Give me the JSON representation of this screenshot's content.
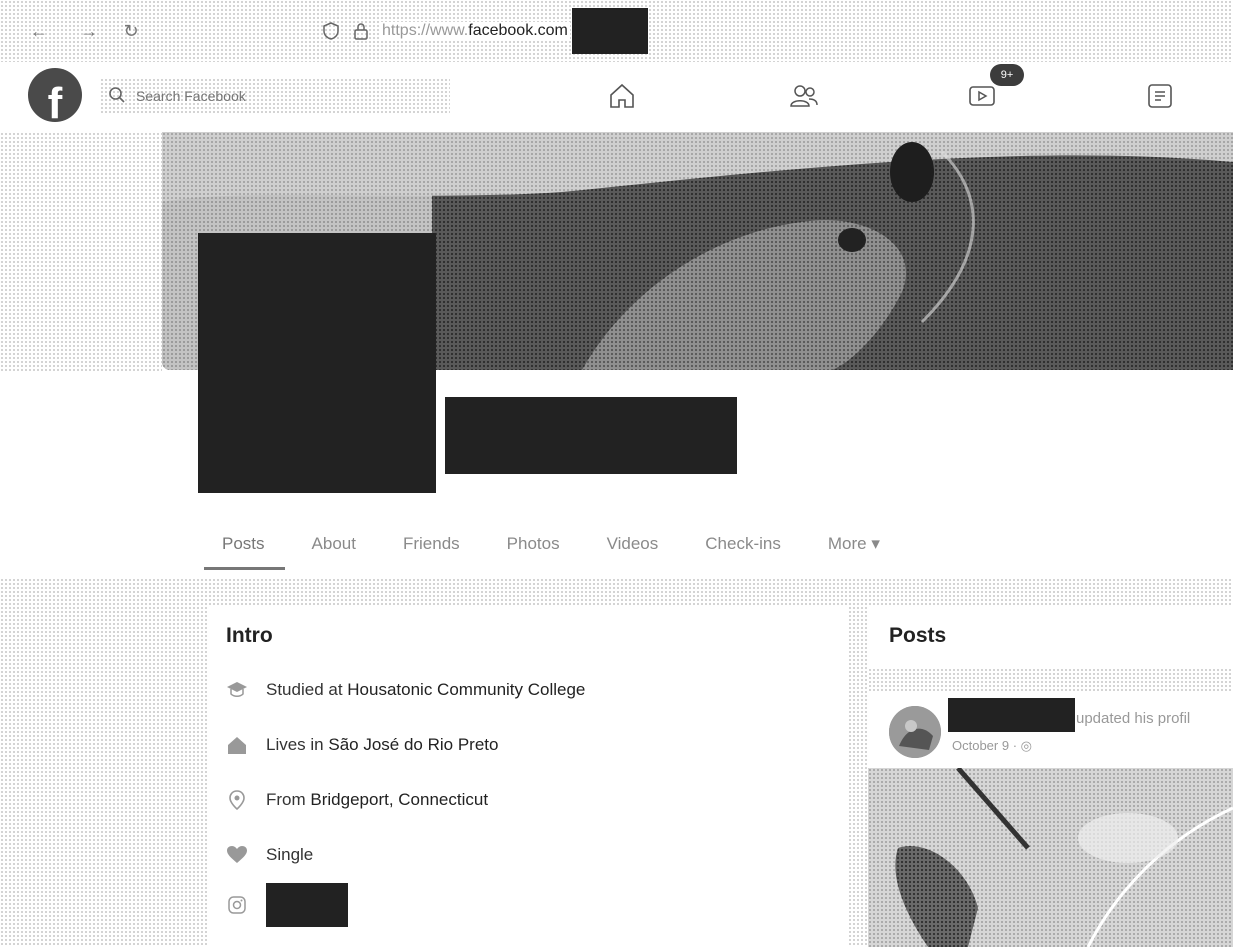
{
  "browser": {
    "url_prefix": "https://www.",
    "url_domain": "facebook.com"
  },
  "header": {
    "logo": "f",
    "search_placeholder": "Search Facebook",
    "watch_badge": "9+"
  },
  "profile": {
    "tabs": [
      {
        "label": "Posts"
      },
      {
        "label": "About"
      },
      {
        "label": "Friends"
      },
      {
        "label": "Photos"
      },
      {
        "label": "Videos"
      },
      {
        "label": "Check-ins"
      },
      {
        "label": "More ▾"
      }
    ]
  },
  "intro": {
    "title": "Intro",
    "studied_prefix": "Studied at ",
    "studied_value": "Housatonic Community College",
    "lives_prefix": "Lives in ",
    "lives_value": "São José do Rio Preto",
    "from_prefix": "From ",
    "from_value": "Bridgeport, Connecticut",
    "relationship": "Single"
  },
  "posts": {
    "title": "Posts",
    "post_action": "updated his profil",
    "post_date": "October 9 · ◎"
  }
}
